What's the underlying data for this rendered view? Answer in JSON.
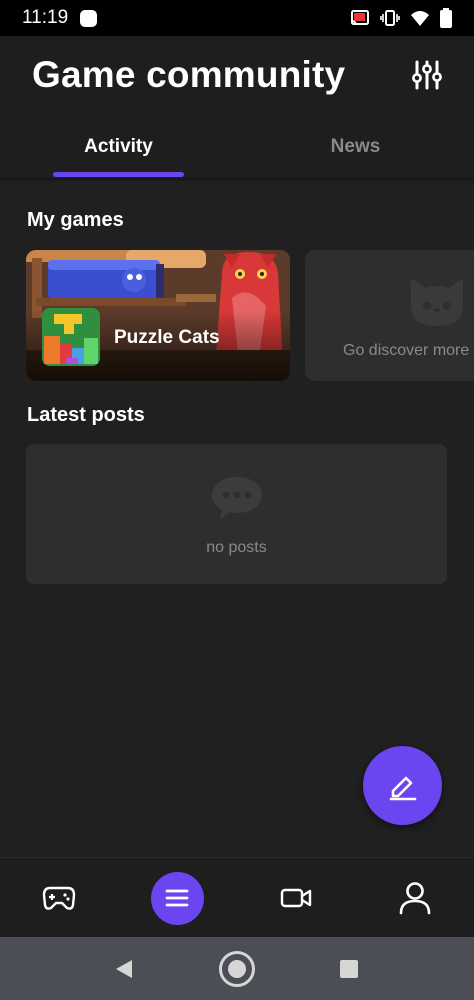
{
  "status_bar": {
    "time": "11:19",
    "icons": [
      "notification-dot-icon",
      "cast-icon",
      "vibrate-icon",
      "wifi-icon",
      "battery-icon"
    ]
  },
  "header": {
    "title": "Game community",
    "filter_icon": "sliders-icon"
  },
  "tabs": [
    {
      "label": "Activity",
      "active": true
    },
    {
      "label": "News",
      "active": false
    }
  ],
  "my_games": {
    "section_title": "My games",
    "games": [
      {
        "name": "Puzzle Cats"
      }
    ],
    "discover": {
      "label": "Go discover more",
      "icon": "cat-face-icon"
    }
  },
  "latest_posts": {
    "section_title": "Latest posts",
    "empty_text": "no posts",
    "empty_icon": "chat-bubble-icon"
  },
  "fab": {
    "icon": "edit-pencil-icon"
  },
  "bottom_nav": [
    {
      "icon": "gamepad-icon",
      "active": false
    },
    {
      "icon": "menu-icon",
      "active": true
    },
    {
      "icon": "video-camera-icon",
      "active": false
    },
    {
      "icon": "profile-icon",
      "active": false
    }
  ],
  "system_nav": [
    "back-icon",
    "home-icon",
    "recents-icon"
  ],
  "colors": {
    "accent": "#6a45f0",
    "background": "#202020",
    "card": "#2e2e2e",
    "muted_text": "#8a8a8a"
  }
}
